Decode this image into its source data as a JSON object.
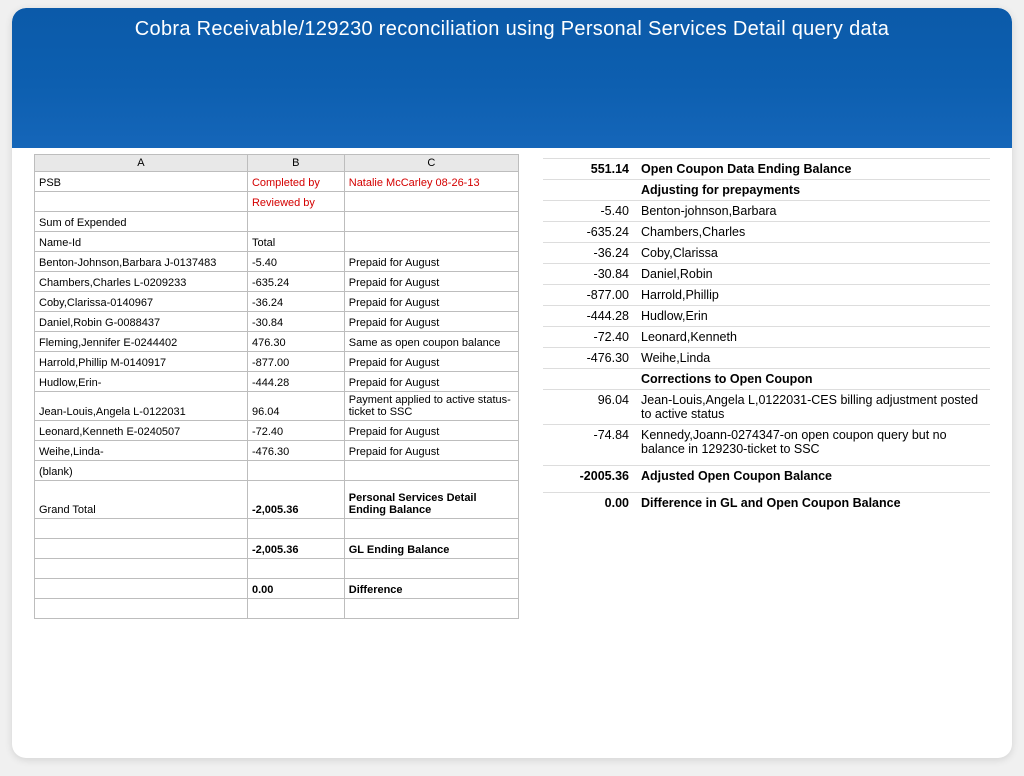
{
  "title": "Cobra Receivable/129230 reconciliation using Personal Services Detail query data",
  "left": {
    "cols": [
      "A",
      "B",
      "C"
    ],
    "row1": {
      "a": "PSB",
      "b": "Completed by",
      "c": "Natalie McCarley 08-26-13"
    },
    "row2": {
      "a": "",
      "b": "Reviewed by",
      "c": ""
    },
    "row3": {
      "a": "Sum of Expended",
      "b": "",
      "c": ""
    },
    "row4": {
      "a": "Name-Id",
      "b": "Total",
      "c": ""
    },
    "data": [
      {
        "a": "Benton-Johnson,Barbara J-0137483",
        "b": "-5.40",
        "c": "Prepaid for August"
      },
      {
        "a": "Chambers,Charles L-0209233",
        "b": "-635.24",
        "c": "Prepaid for August"
      },
      {
        "a": "Coby,Clarissa-0140967",
        "b": "-36.24",
        "c": "Prepaid for August"
      },
      {
        "a": "Daniel,Robin G-0088437",
        "b": "-30.84",
        "c": "Prepaid for August"
      },
      {
        "a": "Fleming,Jennifer E-0244402",
        "b": "476.30",
        "c": "Same as open coupon balance"
      },
      {
        "a": "Harrold,Phillip M-0140917",
        "b": "-877.00",
        "c": "Prepaid for August"
      },
      {
        "a": "Hudlow,Erin-",
        "b": "-444.28",
        "c": "Prepaid for August"
      },
      {
        "a": "Jean-Louis,Angela L-0122031",
        "b": "96.04",
        "c": "Payment applied to active status-ticket to SSC"
      },
      {
        "a": "Leonard,Kenneth E-0240507",
        "b": "-72.40",
        "c": "Prepaid for August"
      },
      {
        "a": "Weihe,Linda-",
        "b": "-476.30",
        "c": "Prepaid for August"
      }
    ],
    "blank": "(blank)",
    "grand": {
      "a": "Grand Total",
      "b": "-2,005.36",
      "c": "Personal Services Detail Ending Balance"
    },
    "gl": {
      "b": "-2,005.36",
      "c": "GL Ending Balance"
    },
    "diff": {
      "b": "0.00",
      "c": "Difference"
    }
  },
  "right": {
    "rows": [
      {
        "amt": "551.14",
        "txt": "Open Coupon Data Ending Balance",
        "hdr": true
      },
      {
        "amt": "",
        "txt": "Adjusting for prepayments",
        "hdr": true
      },
      {
        "amt": "-5.40",
        "txt": "Benton-johnson,Barbara"
      },
      {
        "amt": "-635.24",
        "txt": "Chambers,Charles"
      },
      {
        "amt": "-36.24",
        "txt": "Coby,Clarissa"
      },
      {
        "amt": "-30.84",
        "txt": "Daniel,Robin"
      },
      {
        "amt": "-877.00",
        "txt": "Harrold,Phillip"
      },
      {
        "amt": "-444.28",
        "txt": "Hudlow,Erin"
      },
      {
        "amt": "-72.40",
        "txt": "Leonard,Kenneth"
      },
      {
        "amt": "-476.30",
        "txt": "Weihe,Linda"
      },
      {
        "amt": "",
        "txt": "Corrections to Open Coupon",
        "hdr": true
      },
      {
        "amt": "96.04",
        "txt": "Jean-Louis,Angela L,0122031-CES billing adjustment posted to active status"
      },
      {
        "amt": "-74.84",
        "txt": "Kennedy,Joann-0274347-on open coupon query but no balance in 129230-ticket to SSC"
      },
      {
        "spacer": true
      },
      {
        "amt": "-2005.36",
        "txt": "Adjusted Open Coupon Balance",
        "hdr": true
      },
      {
        "spacer": true
      },
      {
        "amt": "0.00",
        "txt": "Difference in GL and Open Coupon Balance",
        "hdr": true
      }
    ]
  }
}
